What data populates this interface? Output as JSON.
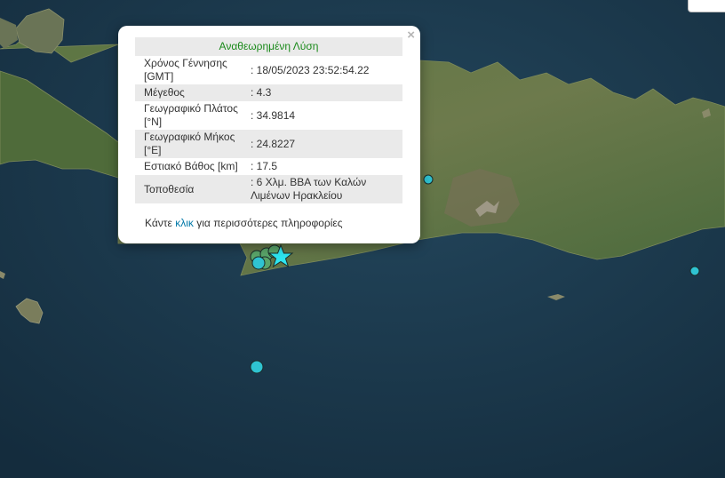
{
  "popup": {
    "heading": "Αναθεωρημένη Λύση",
    "close_glyph": "×",
    "rows": [
      {
        "label": "Χρόνος Γέννησης [GMT]",
        "value": ": 18/05/2023 23:52:54.22"
      },
      {
        "label": "Μέγεθος",
        "value": ": 4.3"
      },
      {
        "label": "Γεωγραφικό Πλάτος [°N]",
        "value": ": 34.9814"
      },
      {
        "label": "Γεωγραφικό Μήκος [°E]",
        "value": ": 24.8227"
      },
      {
        "label": "Εστιακό Βάθος [km]",
        "value": ": 17.5"
      },
      {
        "label": "Τοποθεσία",
        "value": ": 6 Χλμ. ΒΒΑ των Καλών Λιμένων Ηρακλείου"
      }
    ],
    "footer_prefix": "Κάντε",
    "footer_link": "κλικ",
    "footer_suffix": "για περισσότερες πληροφορίες"
  },
  "colors": {
    "sea": "#1b3a4f",
    "land": "#4f6b3a",
    "heading_green": "#1a8a1a",
    "link_blue": "#0078a8",
    "event_cyan": "#2fc3d1",
    "event_green": "#5aa66a",
    "main_event_star": "#2ee6f0"
  },
  "markers": {
    "main_event": "star-icon",
    "other_events": "circle-icon"
  }
}
